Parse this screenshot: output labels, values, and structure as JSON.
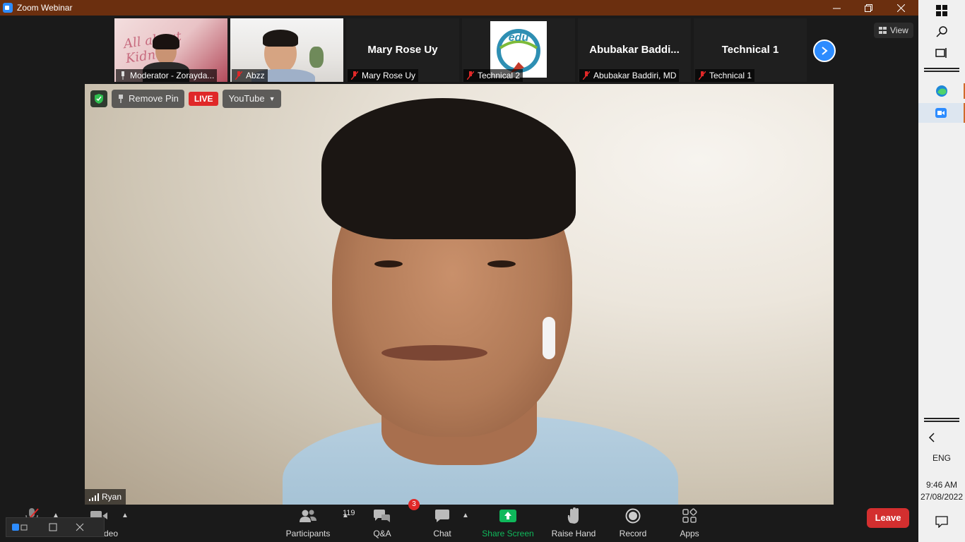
{
  "window": {
    "title": "Zoom Webinar"
  },
  "gallery": {
    "tiles": [
      {
        "name": "Moderator - Zorayda...",
        "type": "video",
        "banner_text": "All about Kidneys"
      },
      {
        "name": "Abzz",
        "type": "video"
      },
      {
        "name": "Mary Rose Uy",
        "type": "name-only",
        "display_name": "Mary Rose Uy"
      },
      {
        "name": "Technical 2",
        "type": "logo",
        "logo_text": "edu"
      },
      {
        "name": "Abubakar Baddiri, MD",
        "type": "name-only",
        "display_name": "Abubakar  Baddi..."
      },
      {
        "name": "Technical 1",
        "type": "name-only",
        "display_name": "Technical 1"
      }
    ],
    "view_label": "View"
  },
  "main_video": {
    "speaker_name": "Ryan",
    "remove_pin_label": "Remove Pin",
    "live_label": "LIVE",
    "stream_label": "YouTube"
  },
  "controls": {
    "video_label": "deo",
    "participants_label": "Participants",
    "participants_count": "119",
    "qa_label": "Q&A",
    "qa_badge": "3",
    "chat_label": "Chat",
    "share_label": "Share Screen",
    "raise_hand_label": "Raise Hand",
    "record_label": "Record",
    "apps_label": "Apps",
    "leave_label": "Leave"
  },
  "taskbar": {
    "lang": "ENG",
    "time": "9:46 AM",
    "date": "27/08/2022"
  },
  "colors": {
    "titlebar": "#6b2f0f",
    "accent": "#2d8cff",
    "share_green": "#0fb85b",
    "leave_red": "#d32f2f",
    "live_red": "#e02828"
  }
}
